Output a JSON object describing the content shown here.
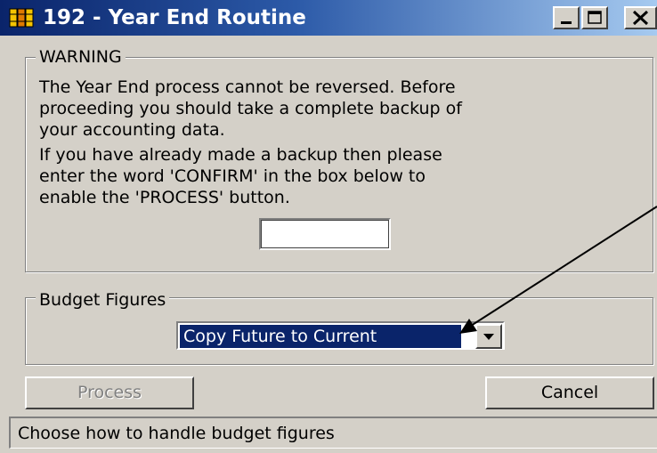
{
  "window": {
    "title": "192 - Year End Routine",
    "icon": "ledger-books-icon",
    "controls": [
      "minimize-icon",
      "maximize-icon",
      "close-icon"
    ]
  },
  "warning": {
    "legend": "WARNING",
    "paragraph1": "The Year End process cannot be reversed. Before\nproceeding you should take a complete backup of\nyour accounting data.",
    "paragraph2": "If you have already made a backup then please\nenter the word 'CONFIRM' in the box below to\nenable the 'PROCESS' button.",
    "confirm_value": ""
  },
  "budget": {
    "legend": "Budget Figures",
    "selected": "Copy Future to Current"
  },
  "buttons": {
    "process": "Process",
    "cancel": "Cancel"
  },
  "status": {
    "text": "Choose how to handle budget figures"
  },
  "annotation": {
    "type": "arrow-icon",
    "points_to": "budget-combo"
  },
  "colors": {
    "title_gradient_start": "#0a246a",
    "title_gradient_end": "#a6caf0",
    "selection": "#0a246a",
    "face": "#d4d0c8"
  }
}
